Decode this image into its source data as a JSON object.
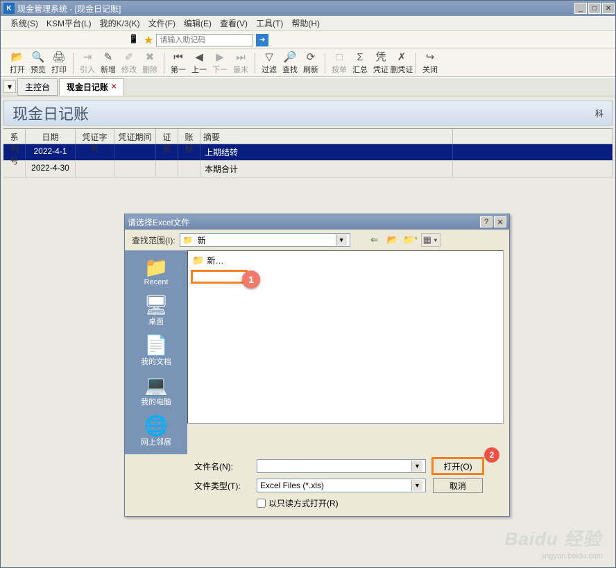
{
  "titlebar": {
    "app_icon_text": "K",
    "title": "现金管理系统 - [现金日记账]"
  },
  "menu": {
    "items": [
      "系统(S)",
      "KSM平台(L)",
      "我的K/3(K)",
      "文件(F)",
      "编辑(E)",
      "查看(V)",
      "工具(T)",
      "帮助(H)"
    ]
  },
  "assist": {
    "placeholder": "请输入助记码"
  },
  "toolbar": {
    "items": [
      {
        "icon": "📂",
        "label": "打开",
        "enabled": true
      },
      {
        "icon": "🔍",
        "label": "预览",
        "enabled": true
      },
      {
        "icon": "🖨",
        "label": "打印",
        "enabled": true
      },
      {
        "sep": true
      },
      {
        "icon": "⇥",
        "label": "引入",
        "enabled": false
      },
      {
        "icon": "✎",
        "label": "新增",
        "enabled": true
      },
      {
        "icon": "✐",
        "label": "修改",
        "enabled": false
      },
      {
        "icon": "✖",
        "label": "删除",
        "enabled": false
      },
      {
        "sep": true
      },
      {
        "icon": "⏮",
        "label": "第一",
        "enabled": true
      },
      {
        "icon": "◀",
        "label": "上一",
        "enabled": true
      },
      {
        "icon": "▶",
        "label": "下一",
        "enabled": false
      },
      {
        "icon": "⏭",
        "label": "最末",
        "enabled": false
      },
      {
        "sep": true
      },
      {
        "icon": "▽",
        "label": "过滤",
        "enabled": true
      },
      {
        "icon": "🔎",
        "label": "查找",
        "enabled": true
      },
      {
        "icon": "⟳",
        "label": "刷新",
        "enabled": true
      },
      {
        "sep": true
      },
      {
        "icon": "□",
        "label": "按单",
        "enabled": false
      },
      {
        "icon": "Σ",
        "label": "汇总",
        "enabled": true
      },
      {
        "icon": "凭",
        "label": "凭证",
        "enabled": true
      },
      {
        "icon": "✗",
        "label": "删凭证",
        "enabled": true
      },
      {
        "sep": true
      },
      {
        "icon": "↪",
        "label": "关闭",
        "enabled": true
      }
    ]
  },
  "tabs": {
    "items": [
      {
        "label": "主控台",
        "active": false,
        "closeable": false
      },
      {
        "label": "现金日记账",
        "active": true,
        "closeable": true
      }
    ]
  },
  "banner": {
    "title": "现金日记账",
    "right": "科"
  },
  "grid": {
    "headers": [
      "系列号",
      "日期",
      "凭证字号",
      "凭证期间",
      "证审",
      "账标",
      "摘要",
      ""
    ],
    "rows": [
      {
        "selected": true,
        "seq": "",
        "date": "2022-4-1",
        "vno": "",
        "vper": "",
        "app": "",
        "flag": "",
        "summ": "上期结转",
        "end": ""
      },
      {
        "selected": false,
        "seq": "",
        "date": "2022-4-30",
        "vno": "",
        "vper": "",
        "app": "",
        "flag": "",
        "summ": "本期合计",
        "end": ""
      }
    ]
  },
  "dialog": {
    "title": "请选择Excel文件",
    "lookin_label": "查找范围(I):",
    "lookin_value": "新",
    "sidebar": [
      {
        "icon": "📁",
        "label": "Recent"
      },
      {
        "icon": "🖥",
        "label": "桌面"
      },
      {
        "icon": "📄",
        "label": "我的文档"
      },
      {
        "icon": "💻",
        "label": "我的电脑"
      },
      {
        "icon": "🌐",
        "label": "网上邻居"
      }
    ],
    "file_item": "新…",
    "filename_label": "文件名(N):",
    "filename_value": "",
    "filetype_label": "文件类型(T):",
    "filetype_value": "Excel Files (*.xls)",
    "readonly_label": "以只读方式打开(R)",
    "open_btn": "打开(O)",
    "cancel_btn": "取消",
    "anno1": "1",
    "anno2": "2"
  },
  "watermark": {
    "main": "Baidu 经验",
    "sub": "jingyan.baidu.com"
  }
}
